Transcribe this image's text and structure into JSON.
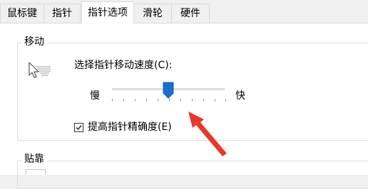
{
  "tabs": [
    {
      "label": "鼠标键",
      "active": false
    },
    {
      "label": "指针",
      "active": false
    },
    {
      "label": "指针选项",
      "active": true
    },
    {
      "label": "滑轮",
      "active": false
    },
    {
      "label": "硬件",
      "active": false
    }
  ],
  "motion": {
    "title": "移动",
    "speed_label": "选择指针移动速度(C):",
    "slow_label": "慢",
    "fast_label": "快",
    "speed_fraction": 0.5,
    "enhance_precision_label": "提高指针精确度(E)",
    "enhance_precision_checked": true
  },
  "snap": {
    "title": "贴靠"
  },
  "annotation": {
    "arrow_color": "#e8382a"
  },
  "icons": {
    "pointer_speed": "pointer-speed-icon",
    "slider_thumb": "slider-thumb-icon",
    "check": "checkmark-icon"
  }
}
